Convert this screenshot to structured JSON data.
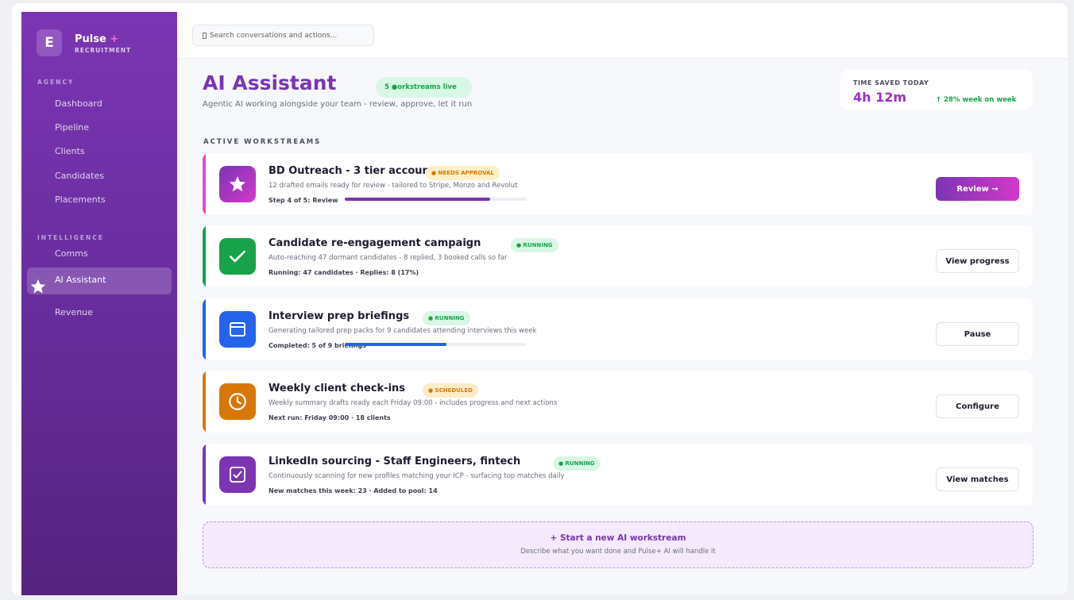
{
  "brand": {
    "logo_letter": "E",
    "name": "Pulse",
    "plus": "+",
    "sub": "RECRUITMENT"
  },
  "sidebar": {
    "sections": [
      {
        "label": "AGENCY",
        "items": [
          "Dashboard",
          "Pipeline",
          "Clients",
          "Candidates",
          "Placements"
        ]
      },
      {
        "label": "INTELLIGENCE",
        "items": [
          "Comms",
          "AI Assistant",
          "Revenue"
        ]
      }
    ],
    "active_item": "AI Assistant"
  },
  "search": {
    "placeholder": "Search conversations and actions..."
  },
  "header": {
    "title": "AI Assistant",
    "live_pill": "5 ●orkstreams live",
    "subtitle": "Agentic AI working alongside your team - review, approve, let it run"
  },
  "time_saved": {
    "label": "TIME SAVED TODAY",
    "value": "4h 12m",
    "delta": "↑ 28% week on week"
  },
  "section_label": "ACTIVE WORKSTREAMS",
  "workstreams": [
    {
      "title": "BD Outreach - 3 tier accounts",
      "badge": "● NEEDS APPROVAL",
      "badge_tone": "amber",
      "desc": "12 drafted emails ready for review - tailored to Stripe, Monzo and Revolut",
      "meta": "Step 4 of 5: Review",
      "progress": 0.8,
      "progress_color": "#7b35b3",
      "button": "Review →",
      "button_primary": true,
      "accent": "#e64ad6",
      "icon": "star-icon"
    },
    {
      "title": "Candidate re-engagement campaign",
      "badge": "● RUNNING",
      "badge_tone": "green",
      "desc": "Auto-reaching 47 dormant candidates - 8 replied, 3 booked calls so far",
      "meta": "Running: 47 candidates · Replies: 8 (17%)",
      "button": "View progress",
      "button_primary": false,
      "accent": "#16a34a",
      "icon": "checkmark-icon"
    },
    {
      "title": "Interview prep briefings",
      "badge": "● RUNNING",
      "badge_tone": "green",
      "desc": "Generating tailored prep packs for 9 candidates attending interviews this week",
      "meta": "Completed: 5 of 9 briefings",
      "progress": 0.56,
      "progress_color": "#2563eb",
      "button": "Pause",
      "button_primary": false,
      "accent": "#2563eb",
      "icon": "window-icon"
    },
    {
      "title": "Weekly client check-ins",
      "badge": "● SCHEDULED",
      "badge_tone": "orange",
      "desc": "Weekly summary drafts ready each Friday 09:00 - includes progress and next actions",
      "meta": "Next run: Friday 09:00 · 18 clients",
      "button": "Configure",
      "button_primary": false,
      "accent": "#d97706",
      "icon": "clock-icon"
    },
    {
      "title": "LinkedIn sourcing - Staff Engineers, fintech",
      "badge": "● RUNNING",
      "badge_tone": "green",
      "desc": "Continuously scanning for new profiles matching your ICP - surfacing top matches daily",
      "meta": "New matches this week: 23 · Added to pool: 14",
      "button": "View matches",
      "button_primary": false,
      "accent": "#7b35b3",
      "icon": "checkbox-icon"
    }
  ],
  "new_workstream": {
    "title": "+ Start a new AI workstream",
    "subtitle": "Describe what you want done and Pulse+ AI will handle it"
  }
}
